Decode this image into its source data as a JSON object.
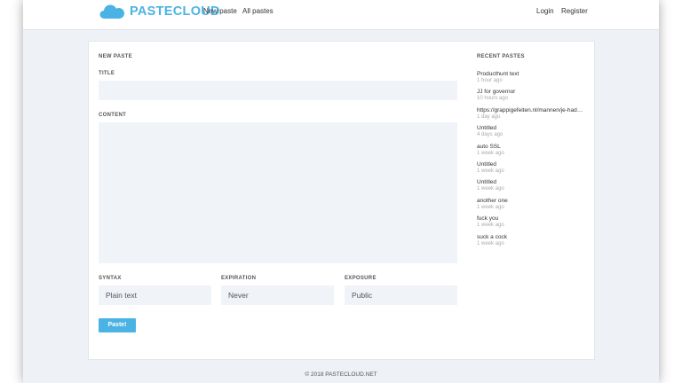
{
  "navbar": {
    "brand": "PASTECLOUD",
    "brand_icon": "cloud-icon",
    "brand_color": "#4bb3e4",
    "links": {
      "new_paste": "New paste",
      "all_pastes": "All pastes",
      "login": "Login",
      "register": "Register"
    }
  },
  "form": {
    "heading": "NEW PASTE",
    "title_label": "TITLE",
    "title_value": "",
    "content_label": "CONTENT",
    "content_value": "",
    "syntax_label": "SYNTAX",
    "syntax_value": "Plain text",
    "expiration_label": "EXPIRATION",
    "expiration_value": "Never",
    "exposure_label": "EXPOSURE",
    "exposure_value": "Public",
    "submit_label": "Paste!"
  },
  "recent": {
    "heading": "RECENT PASTES",
    "items": [
      {
        "name": "Producthunt text",
        "time": "1 hour ago"
      },
      {
        "name": "JJ for governor",
        "time": "10 hours ago"
      },
      {
        "name": "https://grappigefeiten.nl/mannen/je-had-…",
        "time": "1 day ago"
      },
      {
        "name": "Untitled",
        "time": "4 days ago"
      },
      {
        "name": "auto SSL",
        "time": "1 week ago"
      },
      {
        "name": "Untitled",
        "time": "1 week ago"
      },
      {
        "name": "Untitled",
        "time": "1 week ago"
      },
      {
        "name": "another one",
        "time": "1 week ago"
      },
      {
        "name": "fuck you",
        "time": "1 week ago"
      },
      {
        "name": "suck a cock",
        "time": "1 week ago"
      }
    ]
  },
  "footer": {
    "text": "© 2018 PASTECLOUD.NET"
  }
}
